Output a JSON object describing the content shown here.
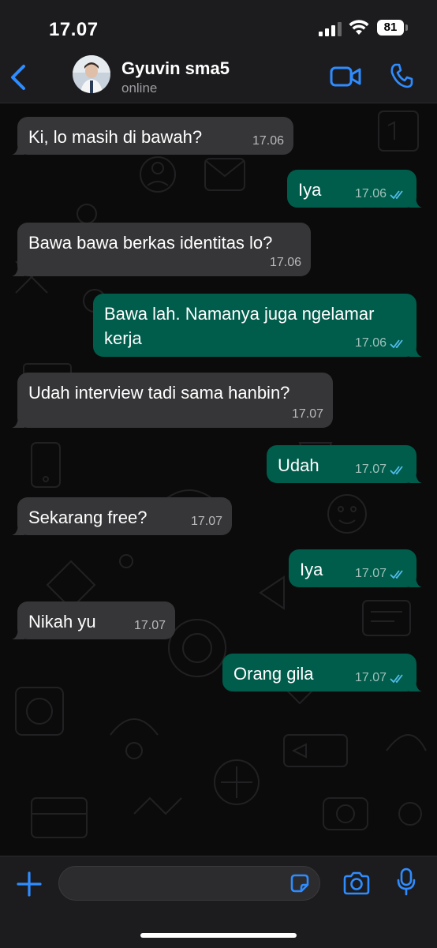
{
  "status_bar": {
    "time": "17.07",
    "battery": "81"
  },
  "header": {
    "contact_name": "Gyuvin sma5",
    "contact_status": "online"
  },
  "colors": {
    "accent": "#2f8cff",
    "incoming_bubble": "#363638",
    "outgoing_bubble": "#005c4b",
    "read_tick": "#53bdeb"
  },
  "messages": [
    {
      "direction": "in",
      "lines": [
        "Ki, lo masih di bawah?"
      ],
      "time": "17.06"
    },
    {
      "direction": "out",
      "lines": [
        "Iya"
      ],
      "time": "17.06",
      "status": "read"
    },
    {
      "direction": "in",
      "lines": [
        "Bawa bawa berkas identitas lo?"
      ],
      "time": "17.06"
    },
    {
      "direction": "out",
      "lines": [
        "Bawa lah. Namanya juga ngelamar",
        "kerja"
      ],
      "time": "17.06",
      "status": "read"
    },
    {
      "direction": "in",
      "lines": [
        "Udah interview tadi sama hanbin?"
      ],
      "time": "17.07"
    },
    {
      "direction": "out",
      "lines": [
        "Udah"
      ],
      "time": "17.07",
      "status": "read"
    },
    {
      "direction": "in",
      "lines": [
        "Sekarang free?"
      ],
      "time": "17.07"
    },
    {
      "direction": "out",
      "lines": [
        "Iya"
      ],
      "time": "17.07",
      "status": "read"
    },
    {
      "direction": "in",
      "lines": [
        "Nikah yu"
      ],
      "time": "17.07"
    },
    {
      "direction": "out",
      "lines": [
        "Orang gila"
      ],
      "time": "17.07",
      "status": "read"
    }
  ],
  "composer": {
    "value": ""
  },
  "icons": {
    "back": "chevron-left-icon",
    "video": "video-camera-icon",
    "call": "phone-icon",
    "plus": "plus-icon",
    "sticker": "sticker-icon",
    "camera": "camera-icon",
    "mic": "microphone-icon"
  }
}
